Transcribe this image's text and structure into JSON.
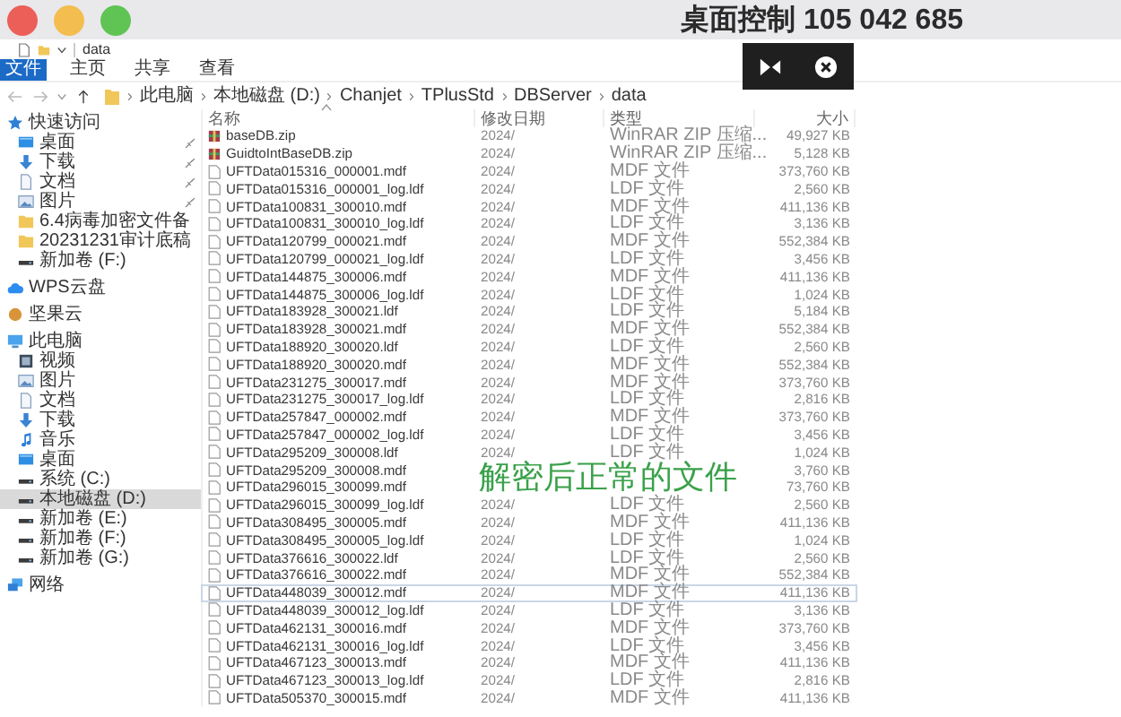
{
  "remote_bar": {
    "title": "桌面控制 105 042 685"
  },
  "window": {
    "title": "data"
  },
  "ribbon_tabs": [
    {
      "label": "文件",
      "selected": true
    },
    {
      "label": "主页",
      "selected": false
    },
    {
      "label": "共享",
      "selected": false
    },
    {
      "label": "查看",
      "selected": false
    }
  ],
  "breadcrumbs": [
    "此电脑",
    "本地磁盘 (D:)",
    "Chanjet",
    "TPlusStd",
    "DBServer",
    "data"
  ],
  "sidebar": [
    {
      "label": "快速访问",
      "kind": "star",
      "selected": false,
      "children": [
        {
          "label": "桌面",
          "kind": "desktop",
          "pinned": true,
          "selected": false
        },
        {
          "label": "下载",
          "kind": "download",
          "pinned": true,
          "selected": false
        },
        {
          "label": "文档",
          "kind": "document",
          "pinned": true,
          "selected": false
        },
        {
          "label": "图片",
          "kind": "picture",
          "pinned": true,
          "selected": false
        },
        {
          "label": "6.4病毒加密文件备",
          "kind": "folder",
          "pinned": false,
          "selected": false
        },
        {
          "label": "20231231审计底稿",
          "kind": "folder",
          "pinned": false,
          "selected": false
        },
        {
          "label": "新加卷 (F:)",
          "kind": "drive",
          "pinned": false,
          "selected": false
        }
      ]
    },
    {
      "label": "WPS云盘",
      "kind": "cloud",
      "selected": false
    },
    {
      "label": "坚果云",
      "kind": "nut",
      "selected": false
    },
    {
      "label": "此电脑",
      "kind": "computer",
      "selected": false,
      "children": [
        {
          "label": "视频",
          "kind": "video",
          "pinned": false,
          "selected": false
        },
        {
          "label": "图片",
          "kind": "picture",
          "pinned": false,
          "selected": false
        },
        {
          "label": "文档",
          "kind": "document",
          "pinned": false,
          "selected": false
        },
        {
          "label": "下载",
          "kind": "download",
          "pinned": false,
          "selected": false
        },
        {
          "label": "音乐",
          "kind": "music",
          "pinned": false,
          "selected": false
        },
        {
          "label": "桌面",
          "kind": "desktop",
          "pinned": false,
          "selected": false
        },
        {
          "label": "系统 (C:)",
          "kind": "drive",
          "pinned": false,
          "selected": false
        },
        {
          "label": "本地磁盘 (D:)",
          "kind": "drive",
          "pinned": false,
          "selected": true
        },
        {
          "label": "新加卷 (E:)",
          "kind": "drive",
          "pinned": false,
          "selected": false
        },
        {
          "label": "新加卷 (F:)",
          "kind": "drive",
          "pinned": false,
          "selected": false
        },
        {
          "label": "新加卷 (G:)",
          "kind": "drive",
          "pinned": false,
          "selected": false
        }
      ]
    },
    {
      "label": "网络",
      "kind": "network",
      "selected": false
    }
  ],
  "table": {
    "columns": [
      "名称",
      "修改日期",
      "类型",
      "大小"
    ],
    "rows": [
      {
        "name": "baseDB.zip",
        "date": "2024/",
        "type": "WinRAR ZIP 压缩...",
        "size": "49,927 KB",
        "kind": "zip",
        "focused": false
      },
      {
        "name": "GuidtoIntBaseDB.zip",
        "date": "2024/",
        "type": "WinRAR ZIP 压缩...",
        "size": "5,128 KB",
        "kind": "zip",
        "focused": false
      },
      {
        "name": "UFTData015316_000001.mdf",
        "date": "2024/",
        "type": "MDF 文件",
        "size": "373,760 KB",
        "kind": "file",
        "focused": false
      },
      {
        "name": "UFTData015316_000001_log.ldf",
        "date": "2024/",
        "type": "LDF 文件",
        "size": "2,560 KB",
        "kind": "file",
        "focused": false
      },
      {
        "name": "UFTData100831_300010.mdf",
        "date": "2024/",
        "type": "MDF 文件",
        "size": "411,136 KB",
        "kind": "file",
        "focused": false
      },
      {
        "name": "UFTData100831_300010_log.ldf",
        "date": "2024/",
        "type": "LDF 文件",
        "size": "3,136 KB",
        "kind": "file",
        "focused": false
      },
      {
        "name": "UFTData120799_000021.mdf",
        "date": "2024/",
        "type": "MDF 文件",
        "size": "552,384 KB",
        "kind": "file",
        "focused": false
      },
      {
        "name": "UFTData120799_000021_log.ldf",
        "date": "2024/",
        "type": "LDF 文件",
        "size": "3,456 KB",
        "kind": "file",
        "focused": false
      },
      {
        "name": "UFTData144875_300006.mdf",
        "date": "2024/",
        "type": "MDF 文件",
        "size": "411,136 KB",
        "kind": "file",
        "focused": false
      },
      {
        "name": "UFTData144875_300006_log.ldf",
        "date": "2024/",
        "type": "LDF 文件",
        "size": "1,024 KB",
        "kind": "file",
        "focused": false
      },
      {
        "name": "UFTData183928_300021.ldf",
        "date": "2024/",
        "type": "LDF 文件",
        "size": "5,184 KB",
        "kind": "file",
        "focused": false
      },
      {
        "name": "UFTData183928_300021.mdf",
        "date": "2024/",
        "type": "MDF 文件",
        "size": "552,384 KB",
        "kind": "file",
        "focused": false
      },
      {
        "name": "UFTData188920_300020.ldf",
        "date": "2024/",
        "type": "LDF 文件",
        "size": "2,560 KB",
        "kind": "file",
        "focused": false
      },
      {
        "name": "UFTData188920_300020.mdf",
        "date": "2024/",
        "type": "MDF 文件",
        "size": "552,384 KB",
        "kind": "file",
        "focused": false
      },
      {
        "name": "UFTData231275_300017.mdf",
        "date": "2024/",
        "type": "MDF 文件",
        "size": "373,760 KB",
        "kind": "file",
        "focused": false
      },
      {
        "name": "UFTData231275_300017_log.ldf",
        "date": "2024/",
        "type": "LDF 文件",
        "size": "2,816 KB",
        "kind": "file",
        "focused": false
      },
      {
        "name": "UFTData257847_000002.mdf",
        "date": "2024/",
        "type": "MDF 文件",
        "size": "373,760 KB",
        "kind": "file",
        "focused": false
      },
      {
        "name": "UFTData257847_000002_log.ldf",
        "date": "2024/",
        "type": "LDF 文件",
        "size": "3,456 KB",
        "kind": "file",
        "focused": false
      },
      {
        "name": "UFTData295209_300008.ldf",
        "date": "2024/",
        "type": "LDF 文件",
        "size": "1,024 KB",
        "kind": "file",
        "focused": false
      },
      {
        "name": "UFTData295209_300008.mdf",
        "size": "3,760 KB",
        "kind": "file",
        "focused": false
      },
      {
        "name": "UFTData296015_300099.mdf",
        "size": "73,760 KB",
        "kind": "file",
        "focused": false
      },
      {
        "name": "UFTData296015_300099_log.ldf",
        "date": "2024/",
        "type": "LDF 文件",
        "size": "2,560 KB",
        "kind": "file",
        "focused": false
      },
      {
        "name": "UFTData308495_300005.mdf",
        "date": "2024/",
        "type": "MDF 文件",
        "size": "411,136 KB",
        "kind": "file",
        "focused": false
      },
      {
        "name": "UFTData308495_300005_log.ldf",
        "date": "2024/",
        "type": "LDF 文件",
        "size": "1,024 KB",
        "kind": "file",
        "focused": false
      },
      {
        "name": "UFTData376616_300022.ldf",
        "date": "2024/",
        "type": "LDF 文件",
        "size": "2,560 KB",
        "kind": "file",
        "focused": false
      },
      {
        "name": "UFTData376616_300022.mdf",
        "date": "2024/",
        "type": "MDF 文件",
        "size": "552,384 KB",
        "kind": "file",
        "focused": false
      },
      {
        "name": "UFTData448039_300012.mdf",
        "date": "2024/",
        "type": "MDF 文件",
        "size": "411,136 KB",
        "kind": "file",
        "focused": true
      },
      {
        "name": "UFTData448039_300012_log.ldf",
        "date": "2024/",
        "type": "LDF 文件",
        "size": "3,136 KB",
        "kind": "file",
        "focused": false
      },
      {
        "name": "UFTData462131_300016.mdf",
        "date": "2024/",
        "type": "MDF 文件",
        "size": "373,760 KB",
        "kind": "file",
        "focused": false
      },
      {
        "name": "UFTData462131_300016_log.ldf",
        "date": "2024/",
        "type": "LDF 文件",
        "size": "3,456 KB",
        "kind": "file",
        "focused": false
      },
      {
        "name": "UFTData467123_300013.mdf",
        "date": "2024/",
        "type": "MDF 文件",
        "size": "411,136 KB",
        "kind": "file",
        "focused": false
      },
      {
        "name": "UFTData467123_300013_log.ldf",
        "date": "2024/",
        "type": "LDF 文件",
        "size": "2,816 KB",
        "kind": "file",
        "focused": false
      },
      {
        "name": "UFTData505370_300015.mdf",
        "date": "2024/",
        "type": "MDF 文件",
        "size": "411,136 KB",
        "kind": "file",
        "focused": false
      }
    ]
  },
  "annotation": "解密后正常的文件"
}
